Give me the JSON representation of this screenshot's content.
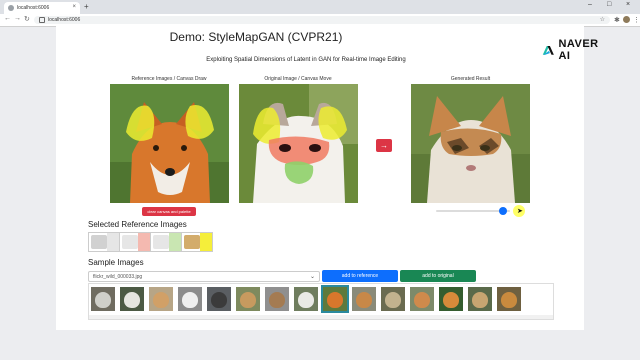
{
  "browser": {
    "tab_title": "localhost:6006",
    "url": "localhost:6006",
    "new_tab_label": "+",
    "tab_close_label": "×",
    "back_label": "←",
    "forward_label": "→",
    "reload_label": "↻",
    "window_minimize": "–",
    "window_maximize": "□",
    "window_close": "×"
  },
  "header": {
    "title": "Demo: StyleMapGAN (CVPR21)",
    "subtitle": "Exploiting Spatial Dimensions of Latent in GAN for Real-time Image Editing",
    "brand": "NAVER AI",
    "brand_color": "#00c73c"
  },
  "panels": {
    "reference_caption": "Reference Images / Canvas Draw",
    "original_caption": "Original Image / Canvas Move",
    "result_caption": "Generated Result",
    "clear_button": "clear canvas and palette",
    "generate_arrow": "→",
    "blend_level": 0.95
  },
  "selected": {
    "heading": "Selected Reference Images",
    "tiles": [
      {
        "color": "#e6e6e6",
        "mark": "#bdbdbd"
      },
      {
        "color": "#f4b9b0",
        "mark": "#dcdcdc"
      },
      {
        "color": "#c9e6b2",
        "mark": "#dcdcdc"
      },
      {
        "color": "#f5ee3a",
        "mark": "#c0892c"
      }
    ]
  },
  "samples": {
    "heading": "Sample Images",
    "selected_file": "flickr_wild_000033.jpg",
    "add_reference_button": "add to reference",
    "add_original_button": "add to original",
    "selected_index": 8,
    "thumbs": [
      {
        "bg": "#6f6c60",
        "fg": "#cfcfc9"
      },
      {
        "bg": "#4c5a44",
        "fg": "#e6e6e0"
      },
      {
        "bg": "#b7a586",
        "fg": "#d1a067"
      },
      {
        "bg": "#8c8c8c",
        "fg": "#efefef"
      },
      {
        "bg": "#5a5e62",
        "fg": "#3b3b3b"
      },
      {
        "bg": "#7e8a5e",
        "fg": "#c79a5f"
      },
      {
        "bg": "#8f8f8f",
        "fg": "#a47b52"
      },
      {
        "bg": "#6f7d5e",
        "fg": "#e9e9e5"
      },
      {
        "bg": "#5e7a3c",
        "fg": "#d8772c"
      },
      {
        "bg": "#8a8b7a",
        "fg": "#c88848"
      },
      {
        "bg": "#6a6b50",
        "fg": "#c2b28e"
      },
      {
        "bg": "#7d8a6a",
        "fg": "#cf8a4c"
      },
      {
        "bg": "#355d2f",
        "fg": "#d68a3a"
      },
      {
        "bg": "#5a6a4a",
        "fg": "#c7a571"
      },
      {
        "bg": "#6e6040",
        "fg": "#c98a3e"
      }
    ]
  }
}
